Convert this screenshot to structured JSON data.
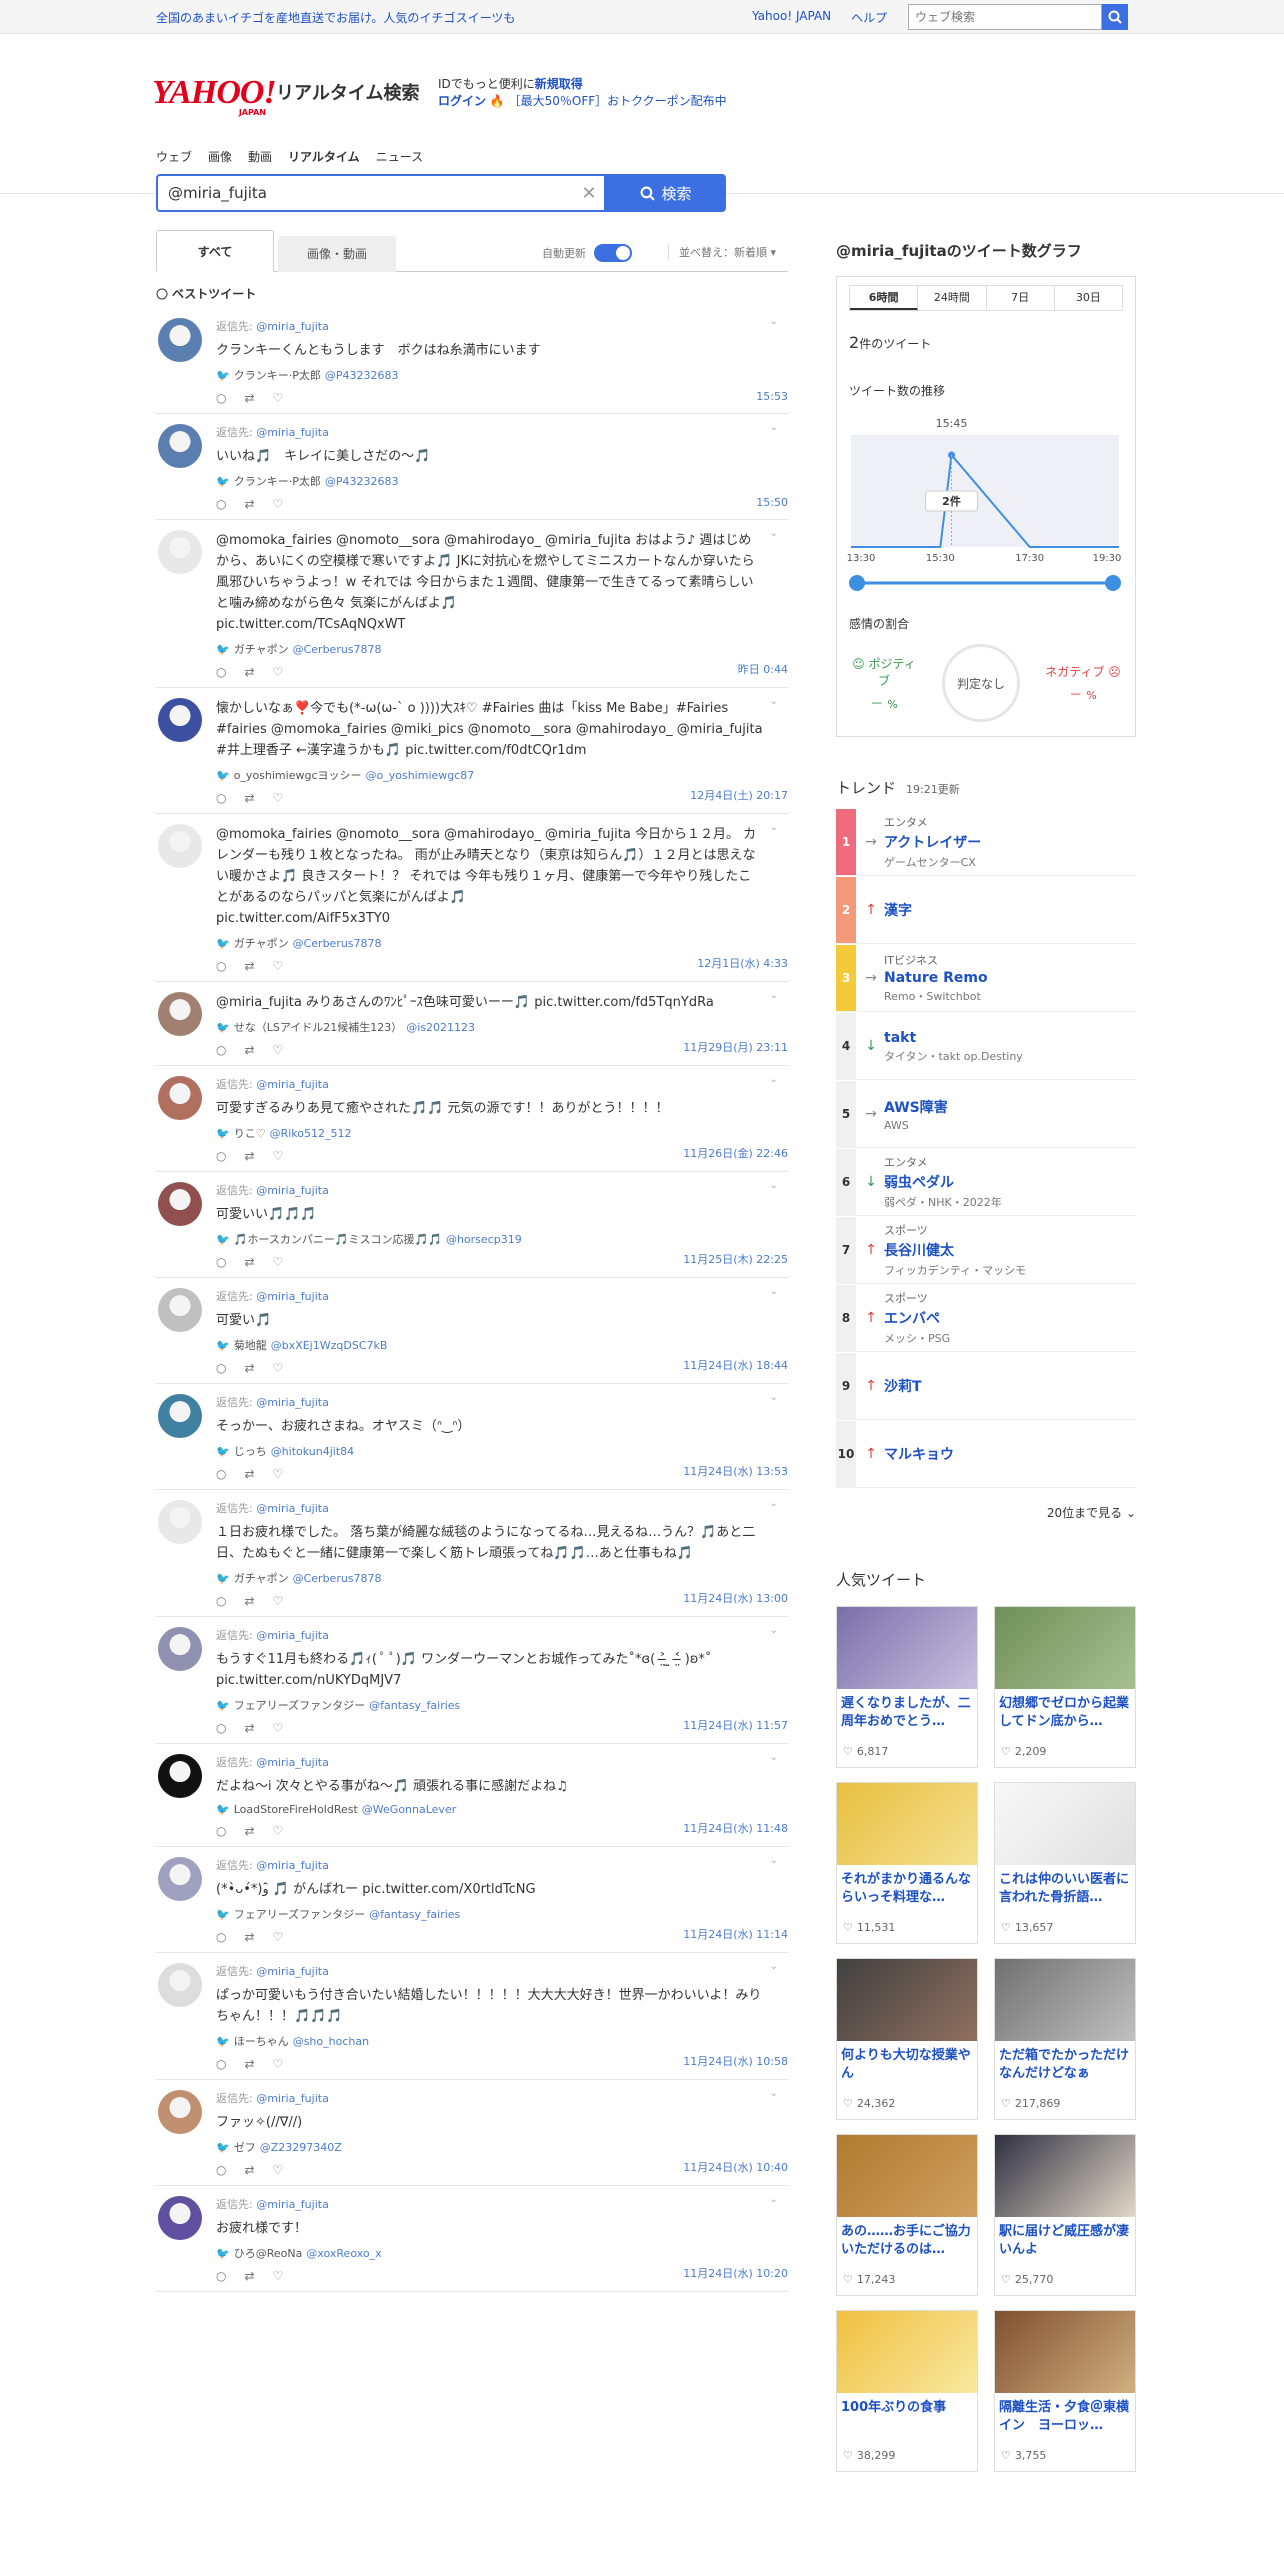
{
  "topbar": {
    "promo": "全国のあまいイチゴを産地直送でお届け。人気のイチゴスイーツも",
    "yahoo_japan": "Yahoo! JAPAN",
    "help": "ヘルプ",
    "web_search_placeholder": "ウェブ検索"
  },
  "header": {
    "logo": "YAHOO!",
    "logo_sub": "JAPAN",
    "service": "リアルタイム検索",
    "id_text": "IDでもっと便利に",
    "new_reg": "新規取得",
    "login": "ログイン",
    "coupon": "［最大50％OFF］おトククーポン配布中"
  },
  "nav": [
    "ウェブ",
    "画像",
    "動画",
    "リアルタイム",
    "ニュース"
  ],
  "search": {
    "query": "@miria_fujita",
    "button": "検索"
  },
  "tabs": {
    "all": "すべて",
    "media": "画像・動画",
    "auto_update": "自動更新",
    "sort": "並べ替え：新着順"
  },
  "best_label": "ベストツイート",
  "tweets": [
    {
      "reply": "返信先:",
      "reply_to": "@miria_fujita",
      "text": "クランキーくんともうします　ボクはね糸満市にいます",
      "name": "クランキー·P太郎",
      "handle": "@P43232683",
      "time": "15:53",
      "av": "#5a7fb0"
    },
    {
      "reply": "返信先:",
      "reply_to": "@miria_fujita",
      "text": "いいね🎵　キレイに美しさだの〜🎵",
      "name": "クランキー·P太郎",
      "handle": "@P43232683",
      "time": "15:50",
      "av": "#5a7fb0"
    },
    {
      "reply": "",
      "reply_to": "",
      "text": "@momoka_fairies @nomoto__sora @mahirodayo_ @miria_fujita おはよう♪ 週はじめから、あいにくの空模様で寒いですよ🎵 JKに対抗心を燃やしてミニスカートなんか穿いたら風邪ひいちゃうよっ！w それでは 今日からまた１週間、健康第一で生きてるって素晴らしいと噛み締めながら色々 気楽にがんばよ🎵\npic.twitter.com/TCsAqNQxWT",
      "name": "ガチャポン",
      "handle": "@Cerberus7878",
      "time": "昨日 0:44",
      "av": "#e8e8e8"
    },
    {
      "reply": "",
      "reply_to": "",
      "text": "懐かしいなぁ❣️今でも(*-ω(ω-` o ))))大ｽｷ♡ #Fairies 曲は「kiss Me Babe」#Fairies #fairies @momoka_fairies @miki_pics @nomoto__sora @mahirodayo_ @miria_fujita #井上理香子 ←漢字違うかも🎵 pic.twitter.com/f0dtCQr1dm",
      "name": "o_yoshimiewgcヨッシー",
      "handle": "@o_yoshimiewgc87",
      "time": "12月4日(土) 20:17",
      "av": "#3c4fa0"
    },
    {
      "reply": "",
      "reply_to": "",
      "text": "@momoka_fairies @nomoto__sora @mahirodayo_ @miria_fujita 今日から１２月。 カレンダーも残り１枚となったね。 雨が止み晴天となり（東京は知らん🎵）１２月とは思えない暖かさよ🎵 良きスタート！？ それでは 今年も残り１ヶ月、健康第一で今年やり残したことがあるのならパッパと気楽にがんばよ🎵\npic.twitter.com/AifF5x3TY0",
      "name": "ガチャポン",
      "handle": "@Cerberus7878",
      "time": "12月1日(水) 4:33",
      "av": "#e8e8e8"
    },
    {
      "reply": "",
      "reply_to": "",
      "text": "@miria_fujita みりあさんのﾜﾝﾋﾟｰｽ色味可愛いーー🎵 pic.twitter.com/fd5TqnYdRa",
      "name": "せな（LSアイドル21候補生123）",
      "handle": "@is2021123",
      "time": "11月29日(月) 23:11",
      "av": "#a08070"
    },
    {
      "reply": "返信先:",
      "reply_to": "@miria_fujita",
      "text": "可愛すぎるみりあ見て癒やされた🎵🎵 元気の源です！！ありがとう！！！！",
      "name": "りこ♡",
      "handle": "@Riko512_512",
      "time": "11月26日(金) 22:46",
      "av": "#b07060"
    },
    {
      "reply": "返信先:",
      "reply_to": "@miria_fujita",
      "text": "可愛いい🎵🎵🎵",
      "name": "🎵ホースカンパニー🎵ミスコン応援🎵🎵",
      "handle": "@horsecp319",
      "time": "11月25日(木) 22:25",
      "av": "#905050"
    },
    {
      "reply": "返信先:",
      "reply_to": "@miria_fujita",
      "text": "可愛い🎵",
      "name": "菊地龍",
      "handle": "@bxXEj1WzqDSC7kB",
      "time": "11月24日(水) 18:44",
      "av": "#c0c0c0"
    },
    {
      "reply": "返信先:",
      "reply_to": "@miria_fujita",
      "text": "そっかー、お疲れさまね。オヤスミ（ᐢ‿ᐢ）",
      "name": "じっち",
      "handle": "@hitokun4jit84",
      "time": "11月24日(水) 13:53",
      "av": "#4080a0"
    },
    {
      "reply": "返信先:",
      "reply_to": "@miria_fujita",
      "text": "１日お疲れ様でした。 落ち葉が綺麗な絨毯のようになってるね…見えるね…うん？🎵あと二日、たぬもぐと一緒に健康第一で楽しく筋トレ頑張ってね🎵🎵…あと仕事もね🎵",
      "name": "ガチャポン",
      "handle": "@Cerberus7878",
      "time": "11月24日(水) 13:00",
      "av": "#e8e8e8"
    },
    {
      "reply": "返信先:",
      "reply_to": "@miria_fujita",
      "text": "もうすぐ11月も終わる🎵ｨ( ﾟ ﾟ)🎵 ワンダーウーマンとお城作ってみた˚*ɞ( ˃̶̤ ̫ ˂̶̤ )ʚ*˚\npic.twitter.com/nUKYDqMJV7",
      "name": "フェアリーズファンタジー",
      "handle": "@fantasy_fairies",
      "time": "11月24日(水) 11:57",
      "av": "#9090b0"
    },
    {
      "reply": "返信先:",
      "reply_to": "@miria_fujita",
      "text": "だよね〜i 次々とやる事がね〜🎵 頑張れる事に感謝だよね♫",
      "name": "LoadStoreFireHoldRest",
      "handle": "@WeGonnaLever",
      "time": "11月24日(水) 11:48",
      "av": "#111111"
    },
    {
      "reply": "返信先:",
      "reply_to": "@miria_fujita",
      "text": "(*•̀ᴗ•́*)و ̑̑🎵 がんばれー pic.twitter.com/X0rtldTcNG",
      "name": "フェアリーズファンタジー",
      "handle": "@fantasy_fairies",
      "time": "11月24日(水) 11:14",
      "av": "#a0a0c0"
    },
    {
      "reply": "返信先:",
      "reply_to": "@miria_fujita",
      "text": "ぱっか可愛いもう付き合いたい結婚したい！！！！！大大大大好き！世界一かわいいよ！みりちゃん！！！🎵🎵🎵",
      "name": "ほーちゃん",
      "handle": "@sho_hochan",
      "time": "11月24日(水) 10:58",
      "av": "#dddddd"
    },
    {
      "reply": "返信先:",
      "reply_to": "@miria_fujita",
      "text": "ファッ✧(//∇//)",
      "name": "ゼフ",
      "handle": "@Z23297340Z",
      "time": "11月24日(水) 10:40",
      "av": "#c09070"
    },
    {
      "reply": "返信先:",
      "reply_to": "@miria_fujita",
      "text": "お疲れ様です！",
      "name": "ひろ@ReoNa",
      "handle": "@xoxReoxo_x",
      "time": "11月24日(水) 10:20",
      "av": "#6050a0"
    }
  ],
  "graph": {
    "title": "@miria_fujitaのツイート数グラフ",
    "tabs": [
      "6時間",
      "24時間",
      "7日",
      "30日"
    ],
    "count": "2",
    "count_unit": "件のツイート",
    "trend_label": "ツイート数の推移",
    "peak_time": "15:45",
    "peak_label": "2件",
    "x_ticks": [
      "13:30",
      "15:30",
      "17:30",
      "19:30"
    ],
    "sentiment_label": "感情の割合",
    "positive": "ポジティブ",
    "negative": "ネガティブ",
    "neutral": "判定なし",
    "pos_val": "－",
    "neg_val": "－",
    "pct": "%"
  },
  "chart_data": {
    "type": "line",
    "x": [
      "13:30",
      "15:30",
      "15:45",
      "17:30",
      "19:30"
    ],
    "values": [
      0,
      0,
      2,
      0,
      0
    ],
    "ylabel": "",
    "xlabel": ""
  },
  "trends": {
    "title": "トレンド",
    "updated": "19:21更新",
    "more": "20位まで見る",
    "items": [
      {
        "rank": "1",
        "cat": "エンタメ",
        "word": "アクトレイザー",
        "sub": "ゲームセンターCX",
        "arrow": "→",
        "color": "#f06a7d",
        "arrow_color": "#888"
      },
      {
        "rank": "2",
        "cat": "",
        "word": "漢字",
        "sub": "",
        "arrow": "↑",
        "color": "#f49a7a",
        "arrow_color": "#e04040"
      },
      {
        "rank": "3",
        "cat": "ITビジネス",
        "word": "Nature Remo",
        "sub": "Remo・Switchbot",
        "arrow": "→",
        "color": "#f4c93a",
        "arrow_color": "#888"
      },
      {
        "rank": "4",
        "cat": "",
        "word": "takt",
        "sub": "タイタン・takt op.Destiny",
        "arrow": "↓",
        "color": "#f0f0f0",
        "arrow_color": "#3a9a50"
      },
      {
        "rank": "5",
        "cat": "",
        "word": "AWS障害",
        "sub": "AWS",
        "arrow": "→",
        "color": "#f0f0f0",
        "arrow_color": "#888"
      },
      {
        "rank": "6",
        "cat": "エンタメ",
        "word": "弱虫ペダル",
        "sub": "弱ペダ・NHK・2022年",
        "arrow": "↓",
        "color": "#f0f0f0",
        "arrow_color": "#3a9a50"
      },
      {
        "rank": "7",
        "cat": "スポーツ",
        "word": "長谷川健太",
        "sub": "フィッカデンティ・マッシモ",
        "arrow": "↑",
        "color": "#f0f0f0",
        "arrow_color": "#e04040"
      },
      {
        "rank": "8",
        "cat": "スポーツ",
        "word": "エンバペ",
        "sub": "メッシ・PSG",
        "arrow": "↑",
        "color": "#f0f0f0",
        "arrow_color": "#e04040"
      },
      {
        "rank": "9",
        "cat": "",
        "word": "沙莉T",
        "sub": "",
        "arrow": "↑",
        "color": "#f0f0f0",
        "arrow_color": "#e04040"
      },
      {
        "rank": "10",
        "cat": "",
        "word": "マルキョウ",
        "sub": "",
        "arrow": "↑",
        "color": "#f0f0f0",
        "arrow_color": "#e04040"
      }
    ]
  },
  "popular": {
    "title": "人気ツイート",
    "items": [
      {
        "text": "遅くなりましたが、二周年おめでとう…",
        "likes": "6,817",
        "c1": "#7a6fa8",
        "c2": "#c9c0e0"
      },
      {
        "text": "幻想郷でゼロから起業してドン底から…",
        "likes": "2,209",
        "c1": "#6f8f5a",
        "c2": "#a8c090"
      },
      {
        "text": "それがまかり通るんならいっそ料理な…",
        "likes": "11,531",
        "c1": "#e8c040",
        "c2": "#f4e090"
      },
      {
        "text": "これは仲のいい医者に言われた骨折語…",
        "likes": "13,657",
        "c1": "#f8f8f8",
        "c2": "#e0e0e0"
      },
      {
        "text": "何よりも大切な授業やん",
        "likes": "24,362",
        "c1": "#404040",
        "c2": "#907060"
      },
      {
        "text": "ただ箱でたかっただけなんだけどなぁ",
        "likes": "217,869",
        "c1": "#707070",
        "c2": "#c0c0c0"
      },
      {
        "text": "あの……お手にご協力いただけるのは…",
        "likes": "17,243",
        "c1": "#b07a30",
        "c2": "#d0a060"
      },
      {
        "text": "駅に届けど威圧感が凄いんよ",
        "likes": "25,770",
        "c1": "#303040",
        "c2": "#e0d8c8"
      },
      {
        "text": "100年ぶりの食事",
        "likes": "38,299",
        "c1": "#f0c040",
        "c2": "#f8e8a0"
      },
      {
        "text": "隔離生活・夕食＠東横イン　ヨーロッ…",
        "likes": "3,755",
        "c1": "#805030",
        "c2": "#d0b080"
      }
    ]
  }
}
